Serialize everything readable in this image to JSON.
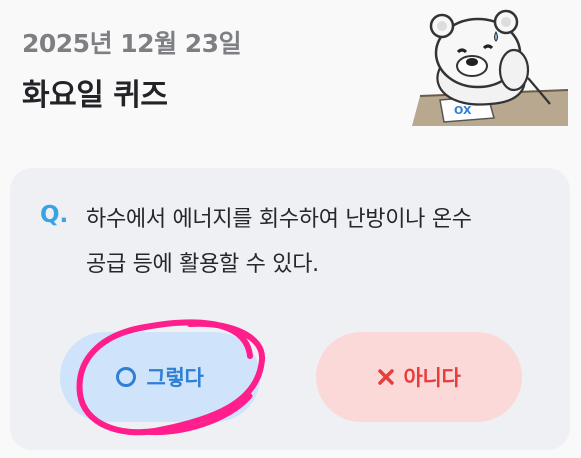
{
  "header": {
    "date": "2025년 12월 23일",
    "title": "화요일 퀴즈"
  },
  "mascot": {
    "paper_text": "OX"
  },
  "quiz": {
    "q_mark": "Q.",
    "question_line1": "하수에서 에너지를 회수하여 난방이나 온수",
    "question_line2": "공급 등에 활용할 수 있다."
  },
  "answers": {
    "yes_label": "그렇다",
    "no_label": "아니다"
  },
  "colors": {
    "accent_blue": "#2f7fd3",
    "accent_red": "#e63d3d",
    "annotation_pink": "#ff1e8c"
  }
}
